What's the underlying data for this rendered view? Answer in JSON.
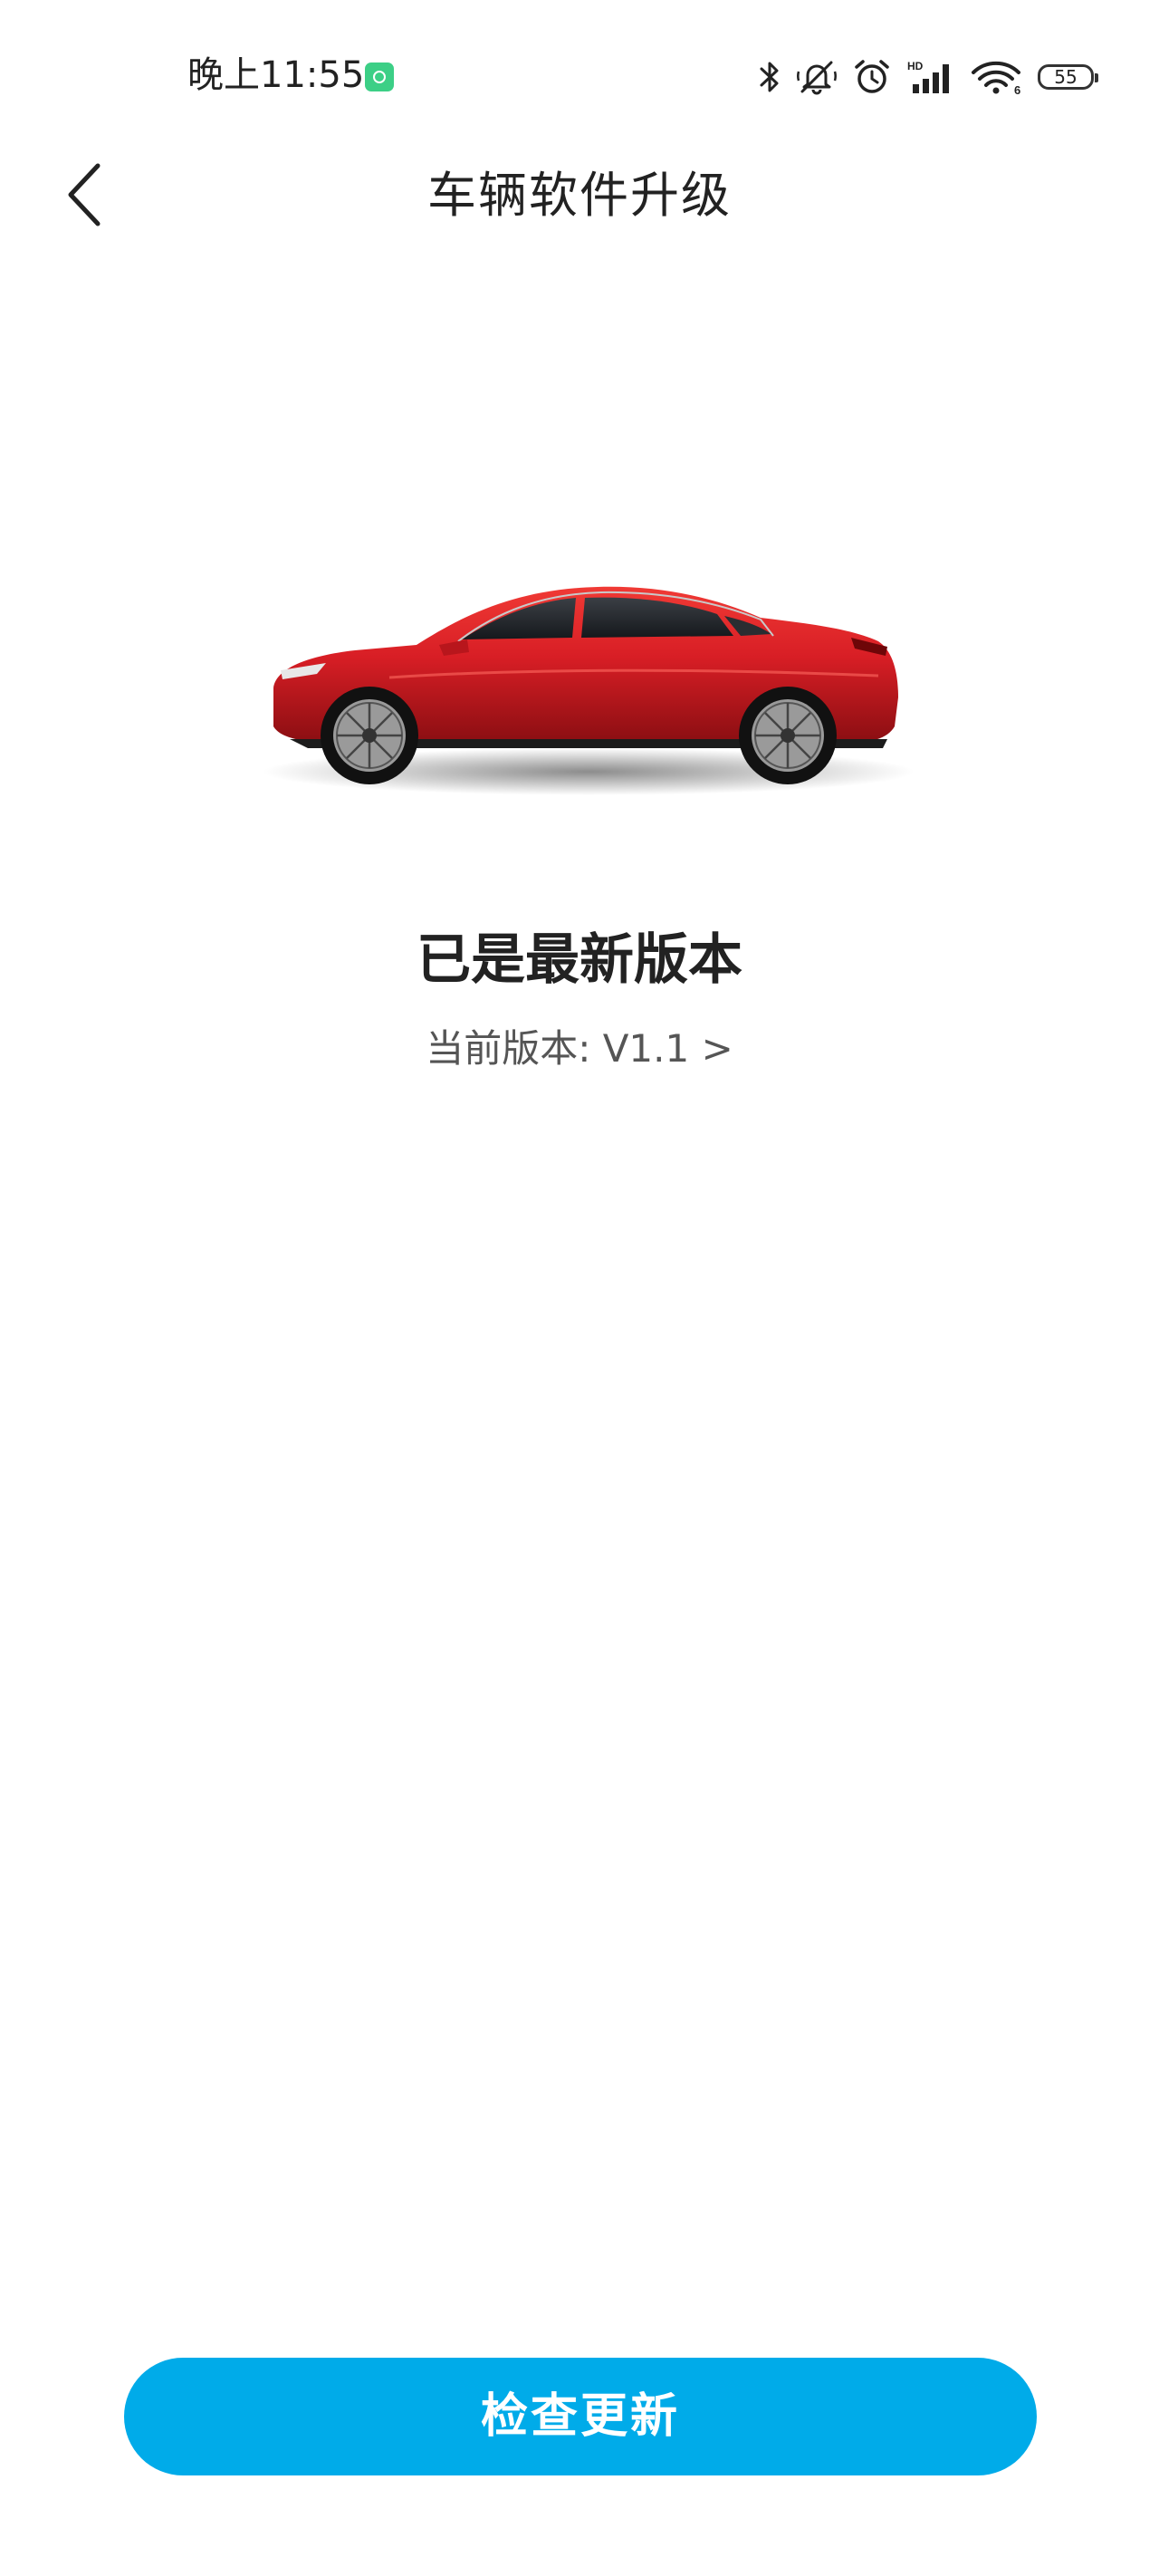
{
  "status_bar": {
    "time": "晚上11:55",
    "battery_level": "55",
    "icons": [
      "app-notification-icon",
      "bluetooth-icon",
      "mute-icon",
      "alarm-icon",
      "cellular-signal-icon",
      "wifi-icon",
      "battery-icon"
    ],
    "signal_badge": "HD",
    "wifi_badge": "6"
  },
  "header": {
    "title": "车辆软件升级",
    "back_icon": "chevron-left-icon"
  },
  "main": {
    "car_image": "red-sedan-image",
    "car_color": "#d81e25",
    "status_text": "已是最新版本",
    "current_version_text": "当前版本: V1.1 >"
  },
  "footer": {
    "check_update_label": "检查更新",
    "button_color": "#00abe9"
  }
}
